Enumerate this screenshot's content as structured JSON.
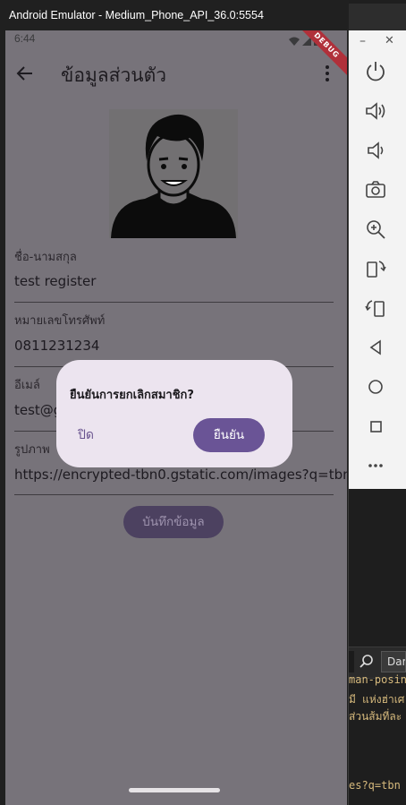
{
  "window": {
    "title": "Android Emulator - Medium_Phone_API_36.0:5554"
  },
  "status_bar": {
    "time": "6:44",
    "debug_banner": "DEBUG"
  },
  "app_bar": {
    "title": "ข้อมูลส่วนตัว"
  },
  "form": {
    "name_label": "ชื่อ-นามสกุล",
    "name_value": "test register",
    "phone_label": "หมายเลขโทรศัพท์",
    "phone_value": "0811231234",
    "email_label": "อีเมล์",
    "email_value": "test@g",
    "image_label": "รูปภาพ",
    "image_value": "https://encrypted-tbn0.gstatic.com/images?q=tbn",
    "save_label": "บันทึกข้อมูล"
  },
  "dialog": {
    "title": "ยืนยันการยกเลิกสมาชิก?",
    "close_label": "ปิด",
    "confirm_label": "ยืนยัน"
  },
  "background": {
    "dropdown_text": "Dar",
    "code_lines": [
      "man-posin",
      "มี แห่งฮ่าเศ",
      "ส่วนส้มที่ละ",
      "es?q=tbn"
    ]
  },
  "colors": {
    "scrim": "#77737a",
    "dialog_bg": "#ece4ef",
    "accent": "#6a5496"
  }
}
